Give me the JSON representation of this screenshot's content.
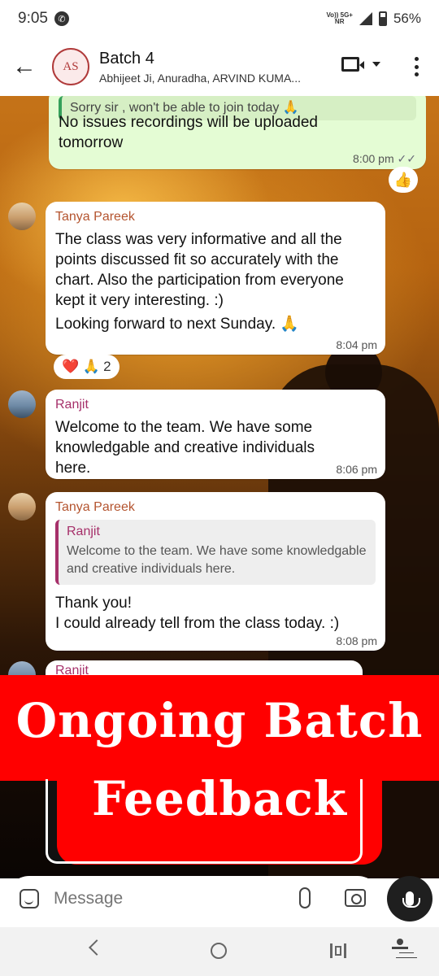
{
  "status_bar": {
    "time": "9:05",
    "network_top": "Vo)) 5G+",
    "network_bottom": "NR",
    "battery": "56%"
  },
  "header": {
    "group_name": "Batch 4",
    "members": "Abhijeet Ji, Anuradha, ARVIND KUMA...",
    "avatar_text": "AS"
  },
  "messages": [
    {
      "id": "m1",
      "direction": "outgoing",
      "quote_text": "Sorry sir , won't be able to join today 🙏",
      "text": "No issues recordings will be uploaded tomorrow",
      "time": "8:00 pm",
      "ticks": "✓✓",
      "reaction": "👍"
    },
    {
      "id": "m2",
      "direction": "incoming",
      "sender": "Tanya Pareek",
      "text": "The class was very informative and all the points discussed fit so accurately with the chart. Also the participation from everyone kept it very interesting. :)",
      "text2": "Looking forward to next Sunday. 🙏",
      "time": "8:04 pm",
      "reactions": "❤️ 🙏",
      "reaction_count": "2"
    },
    {
      "id": "m3",
      "direction": "incoming",
      "sender": "Ranjit",
      "text": "Welcome to the team. We have some knowledgable and creative individuals here.",
      "time": "8:06 pm"
    },
    {
      "id": "m4",
      "direction": "incoming",
      "sender": "Tanya Pareek",
      "quote_name": "Ranjit",
      "quote_text": "Welcome to the team. We have some knowledgable and creative individuals here.",
      "text": "Thank you!",
      "text2": "I could already tell from the class today. :)",
      "time": "8:08 pm"
    },
    {
      "id": "m5",
      "direction": "incoming",
      "sender": "Ranjit"
    }
  ],
  "banner": {
    "line1": "Ongoing Batch",
    "line2": "Feedback",
    "color": "#ff0000"
  },
  "composer": {
    "placeholder": "Message"
  },
  "icons": {
    "back": "arrow-left",
    "video": "video-camera",
    "menu": "vertical-ellipsis",
    "emoji": "sticker",
    "attach": "paperclip",
    "camera": "camera",
    "mic": "microphone"
  }
}
